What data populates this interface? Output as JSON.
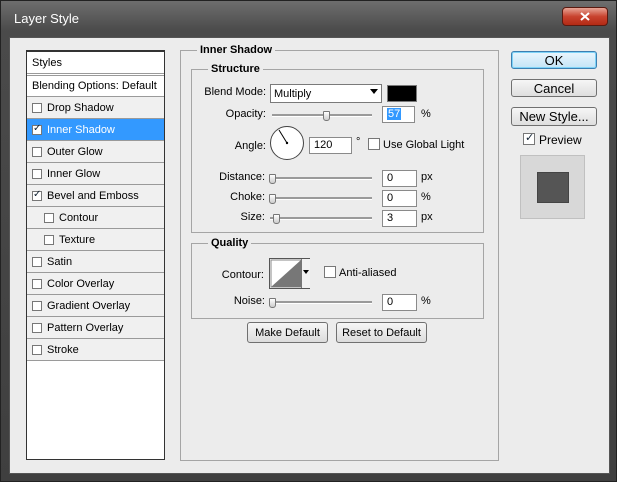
{
  "window": {
    "title": "Layer Style"
  },
  "styles_list": {
    "header": "Styles",
    "blending": "Blending Options: Default",
    "items": [
      {
        "label": "Drop Shadow",
        "checked": false,
        "selected": false,
        "indent": false
      },
      {
        "label": "Inner Shadow",
        "checked": true,
        "selected": true,
        "indent": false
      },
      {
        "label": "Outer Glow",
        "checked": false,
        "selected": false,
        "indent": false
      },
      {
        "label": "Inner Glow",
        "checked": false,
        "selected": false,
        "indent": false
      },
      {
        "label": "Bevel and Emboss",
        "checked": true,
        "selected": false,
        "indent": false
      },
      {
        "label": "Contour",
        "checked": false,
        "selected": false,
        "indent": true
      },
      {
        "label": "Texture",
        "checked": false,
        "selected": false,
        "indent": true
      },
      {
        "label": "Satin",
        "checked": false,
        "selected": false,
        "indent": false
      },
      {
        "label": "Color Overlay",
        "checked": false,
        "selected": false,
        "indent": false
      },
      {
        "label": "Gradient Overlay",
        "checked": false,
        "selected": false,
        "indent": false
      },
      {
        "label": "Pattern Overlay",
        "checked": false,
        "selected": false,
        "indent": false
      },
      {
        "label": "Stroke",
        "checked": false,
        "selected": false,
        "indent": false
      }
    ]
  },
  "inner_shadow": {
    "title": "Inner Shadow",
    "structure": {
      "title": "Structure",
      "blend_mode_label": "Blend Mode:",
      "blend_mode_value": "Multiply",
      "shadow_color": "#000000",
      "opacity_label": "Opacity:",
      "opacity_value": "57",
      "opacity_unit": "%",
      "angle_label": "Angle:",
      "angle_value": "120",
      "angle_unit": "°",
      "use_global_light": "Use Global Light",
      "distance_label": "Distance:",
      "distance_value": "0",
      "distance_unit": "px",
      "choke_label": "Choke:",
      "choke_value": "0",
      "choke_unit": "%",
      "size_label": "Size:",
      "size_value": "3",
      "size_unit": "px"
    },
    "quality": {
      "title": "Quality",
      "contour_label": "Contour:",
      "anti_aliased": "Anti-aliased",
      "noise_label": "Noise:",
      "noise_value": "0",
      "noise_unit": "%"
    },
    "make_default": "Make Default",
    "reset_default": "Reset to Default"
  },
  "buttons": {
    "ok": "OK",
    "cancel": "Cancel",
    "new_style": "New Style...",
    "preview": "Preview",
    "preview_checked": true
  }
}
